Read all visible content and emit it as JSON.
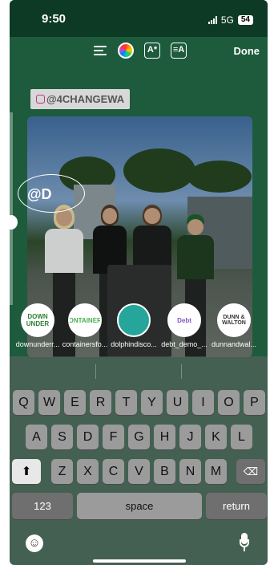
{
  "status_bar": {
    "time": "9:50",
    "network": "5G",
    "battery": "54"
  },
  "toolbar": {
    "align_icon": "text-align-icon",
    "color_icon": "color-wheel-icon",
    "effects_icon": "text-effects-icon",
    "background_icon": "text-background-icon",
    "effects_label": "A*",
    "background_label": "≡A",
    "done_label": "Done"
  },
  "story": {
    "tag_text": "@4CHANGEWA",
    "mention_text": "@D"
  },
  "suggestions": [
    {
      "name": "downunderr...",
      "avatar_label": "DOWN UNDER",
      "color": "#2e7d32"
    },
    {
      "name": "containersfo...",
      "avatar_label": "CONTAINERS",
      "color": "#4caf50"
    },
    {
      "name": "dolphindisco...",
      "avatar_label": "",
      "color": "#26a69a"
    },
    {
      "name": "debt_demo_...",
      "avatar_label": "Debt",
      "color": "#7e57c2"
    },
    {
      "name": "dunnandwal...",
      "avatar_label": "DUNN & WALTON",
      "color": "#222222"
    }
  ],
  "keyboard": {
    "row1": [
      "Q",
      "W",
      "E",
      "R",
      "T",
      "Y",
      "U",
      "I",
      "O",
      "P"
    ],
    "row2": [
      "A",
      "S",
      "D",
      "F",
      "G",
      "H",
      "J",
      "K",
      "L"
    ],
    "row3": [
      "Z",
      "X",
      "C",
      "V",
      "B",
      "N",
      "M"
    ],
    "shift_icon": "shift-arrow-icon",
    "delete_icon": "delete-backspace-icon",
    "shift_glyph": "⬆",
    "delete_glyph": "⌫",
    "numbers_label": "123",
    "space_label": "space",
    "return_label": "return"
  },
  "bottom": {
    "emoji_icon": "emoji-icon",
    "mic_icon": "microphone-icon",
    "emoji_glyph": "☺"
  }
}
